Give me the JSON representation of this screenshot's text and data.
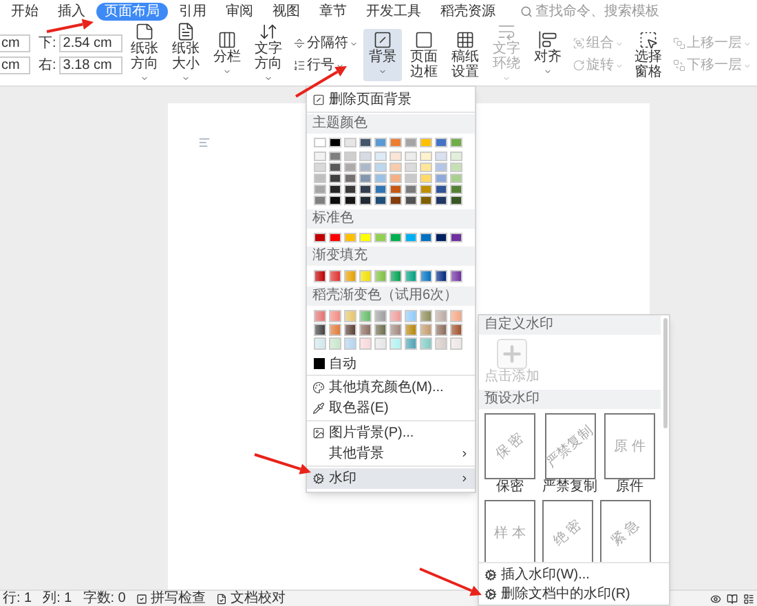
{
  "tabs": [
    {
      "label": "开始",
      "selected": false
    },
    {
      "label": "插入",
      "selected": false
    },
    {
      "label": "页面布局",
      "selected": true
    },
    {
      "label": "引用",
      "selected": false
    },
    {
      "label": "审阅",
      "selected": false
    },
    {
      "label": "视图",
      "selected": false
    },
    {
      "label": "章节",
      "selected": false
    },
    {
      "label": "开发工具",
      "selected": false
    },
    {
      "label": "稻壳资源",
      "selected": false
    }
  ],
  "search": {
    "placeholder": "查找命令、搜索模板"
  },
  "ribbon": {
    "margin_fields": [
      [
        {
          "value": "cm"
        },
        {
          "value": "cm"
        }
      ],
      [
        {
          "label": "下:",
          "value": "2.54 cm"
        },
        {
          "label": "右:",
          "value": "3.18 cm"
        }
      ]
    ],
    "buttons": [
      {
        "kind": "large",
        "label": "纸张方向",
        "dropdown": true,
        "disabled": false,
        "selected": false
      },
      {
        "kind": "large",
        "label": "纸张大小",
        "dropdown": true,
        "disabled": false,
        "selected": false
      },
      {
        "kind": "large",
        "label": "分栏",
        "dropdown": true,
        "disabled": false,
        "selected": false
      },
      {
        "kind": "large",
        "label": "文字方向",
        "dropdown": true,
        "disabled": false,
        "selected": false
      },
      {
        "kind": "pair",
        "items": [
          {
            "label": "分隔符",
            "dropdown": true,
            "disabled": false
          },
          {
            "label": "行号",
            "dropdown": true,
            "disabled": false
          }
        ]
      },
      {
        "kind": "large",
        "label": "背景",
        "dropdown": true,
        "disabled": false,
        "selected": true
      },
      {
        "kind": "large",
        "label": "页面边框",
        "dropdown": false,
        "disabled": false,
        "selected": false
      },
      {
        "kind": "large",
        "label": "稿纸设置",
        "dropdown": false,
        "disabled": false,
        "selected": false
      },
      {
        "kind": "large",
        "label": "文字环绕",
        "dropdown": true,
        "disabled": true,
        "selected": false
      },
      {
        "kind": "large",
        "label": "对齐",
        "dropdown": true,
        "disabled": false,
        "selected": false
      },
      {
        "kind": "pair",
        "items": [
          {
            "label": "组合",
            "dropdown": true,
            "disabled": true
          },
          {
            "label": "旋转",
            "dropdown": true,
            "disabled": true
          }
        ]
      },
      {
        "kind": "large",
        "label": "选择窗格",
        "dropdown": false,
        "disabled": false,
        "selected": false
      },
      {
        "kind": "pair",
        "items": [
          {
            "label": "上移一层",
            "dropdown": true,
            "disabled": true
          },
          {
            "label": "下移一层",
            "dropdown": true,
            "disabled": true
          }
        ]
      }
    ]
  },
  "background_menu": {
    "sections": [
      {
        "items": [
          {
            "kind": "action",
            "label": "删除页面背景",
            "submenu": false,
            "selected": false
          }
        ]
      },
      {
        "items": [
          {
            "kind": "header",
            "label": "主题颜色"
          },
          {
            "kind": "swatch_rows",
            "rows": [
              [
                {
                  "color": "#ffffff"
                },
                {
                  "color": "#000000"
                },
                {
                  "color": "#e7e6e6"
                },
                {
                  "color": "#44546a"
                },
                {
                  "color": "#5b9bd5"
                },
                {
                  "color": "#ed7d31"
                },
                {
                  "color": "#a5a5a5"
                },
                {
                  "color": "#ffc000"
                },
                {
                  "color": "#4472c4"
                },
                {
                  "color": "#70ad47"
                }
              ],
              [
                {
                  "color": "#f2f2f2"
                },
                {
                  "color": "#7f7f7f"
                },
                {
                  "color": "#d0cece"
                },
                {
                  "color": "#d6dce4"
                },
                {
                  "color": "#ddebf7"
                },
                {
                  "color": "#fbe5d6"
                },
                {
                  "color": "#ededed"
                },
                {
                  "color": "#fff2cc"
                },
                {
                  "color": "#d9e1f2"
                },
                {
                  "color": "#e2efda"
                }
              ],
              [
                {
                  "color": "#d9d9d9"
                },
                {
                  "color": "#595959"
                },
                {
                  "color": "#aeaaaa"
                },
                {
                  "color": "#adb9ca"
                },
                {
                  "color": "#bdd7ee"
                },
                {
                  "color": "#f8cbad"
                },
                {
                  "color": "#dbdbdb"
                },
                {
                  "color": "#ffe699"
                },
                {
                  "color": "#b4c6e7"
                },
                {
                  "color": "#c6e0b4"
                }
              ],
              [
                {
                  "color": "#bfbfbf"
                },
                {
                  "color": "#404040"
                },
                {
                  "color": "#757171"
                },
                {
                  "color": "#8497b0"
                },
                {
                  "color": "#9bc2e6"
                },
                {
                  "color": "#f4b084"
                },
                {
                  "color": "#c9c9c9"
                },
                {
                  "color": "#ffd966"
                },
                {
                  "color": "#8ea9db"
                },
                {
                  "color": "#a9d08e"
                }
              ],
              [
                {
                  "color": "#a6a6a6"
                },
                {
                  "color": "#262626"
                },
                {
                  "color": "#3a3838"
                },
                {
                  "color": "#333f4f"
                },
                {
                  "color": "#2f75b5"
                },
                {
                  "color": "#c65911"
                },
                {
                  "color": "#7b7b7b"
                },
                {
                  "color": "#bf8f00"
                },
                {
                  "color": "#305496"
                },
                {
                  "color": "#548235"
                }
              ],
              [
                {
                  "color": "#808080"
                },
                {
                  "color": "#0d0d0d"
                },
                {
                  "color": "#161616"
                },
                {
                  "color": "#222b35"
                },
                {
                  "color": "#1f4e78"
                },
                {
                  "color": "#843c0c"
                },
                {
                  "color": "#525252"
                },
                {
                  "color": "#806000"
                },
                {
                  "color": "#203764"
                },
                {
                  "color": "#375623"
                }
              ]
            ]
          },
          {
            "kind": "header",
            "label": "标准色"
          },
          {
            "kind": "swatch_rows",
            "rows": [
              [
                {
                  "color": "#c00000"
                },
                {
                  "color": "#ff0000"
                },
                {
                  "color": "#ffc000"
                },
                {
                  "color": "#ffff00"
                },
                {
                  "color": "#92d050"
                },
                {
                  "color": "#00b050"
                },
                {
                  "color": "#00b0f0"
                },
                {
                  "color": "#0070c0"
                },
                {
                  "color": "#002060"
                },
                {
                  "color": "#7030a0"
                }
              ]
            ]
          },
          {
            "kind": "header",
            "label": "渐变填充"
          },
          {
            "kind": "gradient_rows",
            "rows": [
              [
                {
                  "color": "#c00000"
                },
                {
                  "color": "#e03030"
                },
                {
                  "color": "#e8a000"
                },
                {
                  "color": "#f0e000"
                },
                {
                  "color": "#7cc040"
                },
                {
                  "color": "#00a050"
                },
                {
                  "color": "#00a080"
                },
                {
                  "color": "#0070c0"
                },
                {
                  "color": "#002880"
                },
                {
                  "color": "#7030a0"
                }
              ]
            ]
          },
          {
            "kind": "header",
            "label": "稻壳渐变色（试用6次）"
          },
          {
            "kind": "gradient_rows",
            "rows": [
              [
                {
                  "color": "#e57373"
                },
                {
                  "color": "#f28b82"
                },
                {
                  "color": "#e6c66b"
                },
                {
                  "color": "#66bb6a"
                },
                {
                  "color": "#9e9e9e"
                },
                {
                  "color": "#ef9a9a"
                },
                {
                  "color": "#90caf9"
                },
                {
                  "color": "#8d8d5a"
                },
                {
                  "color": "#bcaaa4"
                },
                {
                  "color": "#f4a582"
                }
              ],
              [
                {
                  "color": "#424242"
                },
                {
                  "color": "#e07b39"
                },
                {
                  "color": "#5d4037"
                },
                {
                  "color": "#8d6e63"
                },
                {
                  "color": "#6d6d4f"
                },
                {
                  "color": "#a1887f"
                },
                {
                  "color": "#b8860b"
                },
                {
                  "color": "#c49a6c"
                },
                {
                  "color": "#8b6d5c"
                },
                {
                  "color": "#a0522d"
                }
              ],
              [
                {
                  "color": "#d0e8ec"
                },
                {
                  "color": "#c8e6c9"
                },
                {
                  "color": "#b3d4f0"
                },
                {
                  "color": "#f8d7da"
                },
                {
                  "color": "#e6e6e6"
                },
                {
                  "color": "#b2f0f0"
                },
                {
                  "color": "#4fa3b5"
                },
                {
                  "color": "#80cbc4"
                },
                {
                  "color": "#d7ccc8"
                },
                {
                  "color": "#ede7e6"
                }
              ]
            ]
          },
          {
            "kind": "auto",
            "label": "自动",
            "color": "#000000"
          }
        ]
      },
      {
        "items": [
          {
            "kind": "action",
            "label": "其他填充颜色(M)...",
            "submenu": false,
            "selected": false
          },
          {
            "kind": "action",
            "label": "取色器(E)",
            "submenu": false,
            "selected": false
          }
        ]
      },
      {
        "items": [
          {
            "kind": "action",
            "label": "图片背景(P)...",
            "submenu": false,
            "selected": false
          },
          {
            "kind": "action",
            "label": "其他背景",
            "submenu": true,
            "selected": false
          }
        ]
      },
      {
        "items": [
          {
            "kind": "action",
            "label": "水印",
            "submenu": true,
            "selected": true
          }
        ]
      }
    ]
  },
  "watermark_menu": {
    "sections": [
      {
        "header": "自定义水印",
        "tiles": [
          {
            "kind": "add",
            "label": "点击添加"
          }
        ]
      },
      {
        "header": "预设水印",
        "tiles": [
          {
            "kind": "preset",
            "text": "保 密",
            "tilted": true,
            "label": "保密"
          },
          {
            "kind": "preset",
            "text": "严禁复制",
            "tilted": true,
            "label": "严禁复制"
          },
          {
            "kind": "preset",
            "text": "原 件",
            "tilted": false,
            "label": "原件"
          },
          {
            "kind": "preset",
            "text": "样 本",
            "tilted": false
          },
          {
            "kind": "preset",
            "text": "绝 密",
            "tilted": true
          },
          {
            "kind": "preset",
            "text": "紧 急",
            "tilted": true
          }
        ]
      }
    ],
    "footer": [
      {
        "label": "插入水印(W)..."
      },
      {
        "label": "删除文档中的水印(R)"
      }
    ]
  },
  "status_bar": {
    "fields": [
      "行: 1",
      "列: 1",
      "字数: 0"
    ],
    "toggles": [
      {
        "label": "拼写检查"
      },
      {
        "label": "文档校对"
      }
    ]
  }
}
